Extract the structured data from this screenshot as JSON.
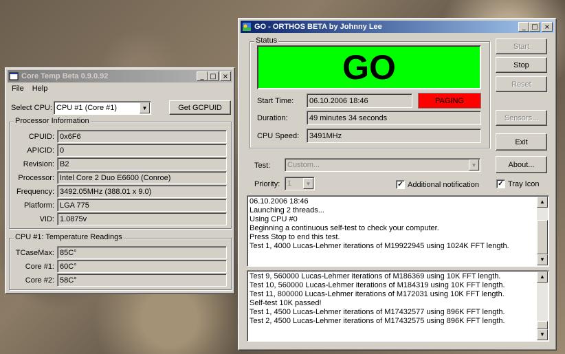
{
  "coretemp": {
    "title": "Core Temp Beta 0.9.0.92",
    "menu": [
      "File",
      "Help"
    ],
    "select_cpu_label": "Select CPU:",
    "select_cpu_value": "CPU #1 (Core #1)",
    "get_gcpuid_label": "Get GCPUID",
    "processor_info": {
      "title": "Processor Information",
      "fields": [
        {
          "label": "CPUID:",
          "value": "0x6F6"
        },
        {
          "label": "APICID:",
          "value": "0"
        },
        {
          "label": "Revision:",
          "value": "B2"
        },
        {
          "label": "Processor:",
          "value": "Intel Core 2 Duo E6600 (Conroe)"
        },
        {
          "label": "Frequency:",
          "value": "3492.05MHz (388.01 x 9.0)"
        },
        {
          "label": "Platform:",
          "value": "LGA 775"
        },
        {
          "label": "VID:",
          "value": "1.0875v"
        }
      ]
    },
    "temps": {
      "title": "CPU #1: Temperature Readings",
      "fields": [
        {
          "label": "TCaseMax:",
          "value": "85C°"
        },
        {
          "label": "Core #1:",
          "value": "60C°"
        },
        {
          "label": "Core #2:",
          "value": "58C°"
        }
      ]
    }
  },
  "orthos": {
    "title": "GO - ORTHOS BETA by Johnny Lee",
    "status_group": "Status",
    "go_text": "GO",
    "go_color": "#00ff00",
    "start_time_label": "Start Time:",
    "start_time_value": "06.10.2006 18:46",
    "paging_text": "PAGING",
    "paging_color": "#ff0000",
    "duration_label": "Duration:",
    "duration_value": "49 minutes 34 seconds",
    "cpu_speed_label": "CPU Speed:",
    "cpu_speed_value": "3491MHz",
    "buttons": {
      "start": "Start",
      "stop": "Stop",
      "reset": "Reset",
      "sensors": "Sensors...",
      "exit": "Exit",
      "about": "About..."
    },
    "test_label": "Test:",
    "test_value": "Custom...",
    "priority_label": "Priority:",
    "priority_value": "1",
    "additional_notification": "Additional notification",
    "tray_icon": "Tray Icon",
    "log1": [
      "06.10.2006 18:46",
      "Launching 2 threads...",
      "Using CPU #0",
      "Beginning a continuous self-test to check your computer.",
      "Press Stop to end this test.",
      "Test 1, 4000 Lucas-Lehmer iterations of M19922945 using 1024K FFT length."
    ],
    "log2": [
      "Test 9, 560000 Lucas-Lehmer iterations of M186369 using 10K FFT length.",
      "Test 10, 560000 Lucas-Lehmer iterations of M184319 using 10K FFT length.",
      "Test 11, 800000 Lucas-Lehmer iterations of M172031 using 10K FFT length.",
      "Self-test 10K passed!",
      "Test 1, 4500 Lucas-Lehmer iterations of M17432577 using 896K FFT length.",
      "Test 2, 4500 Lucas-Lehmer iterations of M17432575 using 896K FFT length."
    ]
  }
}
